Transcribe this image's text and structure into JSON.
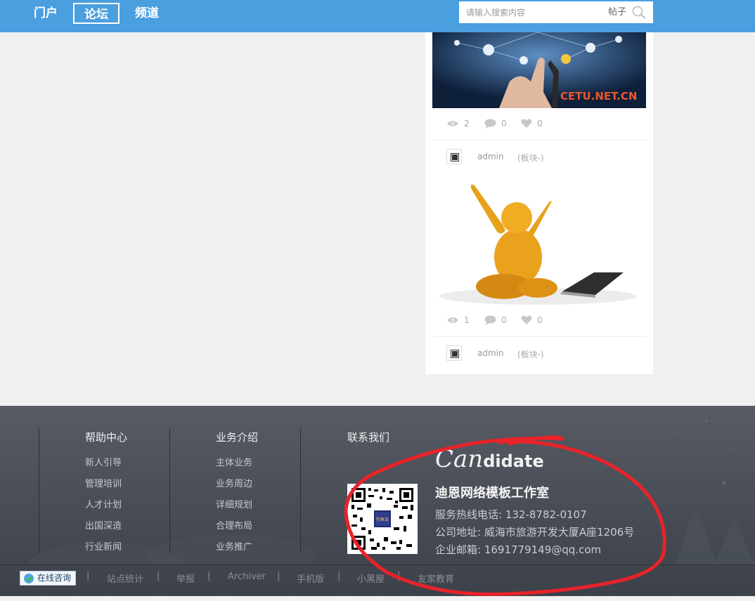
{
  "nav": {
    "items": [
      {
        "label": "门户"
      },
      {
        "label": "论坛",
        "active": true
      },
      {
        "label": "频道"
      }
    ],
    "accent": "#4a9fdf"
  },
  "search": {
    "placeholder": "请输入搜索内容",
    "type": "帖子",
    "icon": "search-icon"
  },
  "posts": [
    {
      "image_label": "CETU.NET.CN",
      "views": "2",
      "comments": "0",
      "likes": "0",
      "author": "admin",
      "board": "(板块-)"
    },
    {
      "views": "1",
      "comments": "0",
      "likes": "0",
      "author": "admin",
      "board": "(板块-)"
    }
  ],
  "footer": {
    "help": {
      "title": "帮助中心",
      "links": [
        "新人引导",
        "管理培训",
        "人才计划",
        "出国深造",
        "行业新闻"
      ]
    },
    "business": {
      "title": "业务介绍",
      "links": [
        "主体业务",
        "业务周边",
        "详细规划",
        "合理布局",
        "业务推广"
      ]
    },
    "contact": {
      "title": "联系我们",
      "brand_script": "Can",
      "brand_rest": "didate",
      "qr_badge": "钓鱼岛",
      "company": "迪恩网络模板工作室",
      "phone": "服务热线电话: 132-8782-0107",
      "address": "公司地址: 威海市旅游开发大厦A座1206号",
      "email": "企业邮箱: 1691779149@qq.com"
    },
    "bottom": {
      "consult": "在线咨询",
      "links": [
        "站点统计",
        "举报",
        "Archiver",
        "手机版",
        "小黑屋",
        "友家教育"
      ]
    },
    "annotation_color": "#e8232a"
  }
}
